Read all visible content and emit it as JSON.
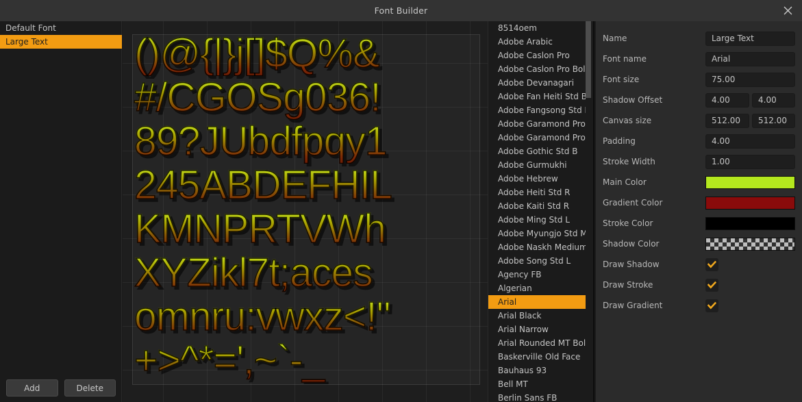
{
  "window": {
    "title": "Font Builder",
    "close_icon": "close-icon"
  },
  "left_panel": {
    "documents": [
      {
        "label": "Default Font",
        "selected": false
      },
      {
        "label": "Large Text",
        "selected": true
      }
    ],
    "add_label": "Add",
    "delete_label": "Delete"
  },
  "canvas": {
    "atlas_rows": [
      "()@{|}j[]$Q%&",
      "#/CGOSg036!",
      "89?JUbdfpqy1",
      "245ABDEFHIL",
      "KMNPRTVWh",
      "XYZikl7t;aces",
      "omnru:vwxz<!\"",
      "+>^*=',~`-_"
    ]
  },
  "font_list": {
    "items": [
      {
        "label": "8514oem",
        "selected": false
      },
      {
        "label": "Adobe Arabic",
        "selected": false
      },
      {
        "label": "Adobe Caslon Pro",
        "selected": false
      },
      {
        "label": "Adobe Caslon Pro Bold",
        "selected": false
      },
      {
        "label": "Adobe Devanagari",
        "selected": false
      },
      {
        "label": "Adobe Fan Heiti Std B",
        "selected": false
      },
      {
        "label": "Adobe Fangsong Std R",
        "selected": false
      },
      {
        "label": "Adobe Garamond Pro",
        "selected": false
      },
      {
        "label": "Adobe Garamond Pro B...",
        "selected": false
      },
      {
        "label": "Adobe Gothic Std B",
        "selected": false
      },
      {
        "label": "Adobe Gurmukhi",
        "selected": false
      },
      {
        "label": "Adobe Hebrew",
        "selected": false
      },
      {
        "label": "Adobe Heiti Std R",
        "selected": false
      },
      {
        "label": "Adobe Kaiti Std R",
        "selected": false
      },
      {
        "label": "Adobe Ming Std L",
        "selected": false
      },
      {
        "label": "Adobe Myungjo Std M",
        "selected": false
      },
      {
        "label": "Adobe Naskh Medium",
        "selected": false
      },
      {
        "label": "Adobe Song Std L",
        "selected": false
      },
      {
        "label": "Agency FB",
        "selected": false
      },
      {
        "label": "Algerian",
        "selected": false
      },
      {
        "label": "Arial",
        "selected": true
      },
      {
        "label": "Arial Black",
        "selected": false
      },
      {
        "label": "Arial Narrow",
        "selected": false
      },
      {
        "label": "Arial Rounded MT Bold",
        "selected": false
      },
      {
        "label": "Baskerville Old Face",
        "selected": false
      },
      {
        "label": "Bauhaus 93",
        "selected": false
      },
      {
        "label": "Bell MT",
        "selected": false
      },
      {
        "label": "Berlin Sans FB",
        "selected": false
      }
    ]
  },
  "properties": {
    "name": {
      "label": "Name",
      "value": "Large Text"
    },
    "font_name": {
      "label": "Font name",
      "value": "Arial"
    },
    "font_size": {
      "label": "Font size",
      "value": "75.00"
    },
    "shadow_offset": {
      "label": "Shadow Offset",
      "x": "4.00",
      "y": "4.00"
    },
    "canvas_size": {
      "label": "Canvas size",
      "width": "512.00",
      "height": "512.00"
    },
    "padding": {
      "label": "Padding",
      "value": "4.00"
    },
    "stroke_width": {
      "label": "Stroke Width",
      "value": "1.00"
    },
    "main_color": {
      "label": "Main Color",
      "value": "#b4e81e"
    },
    "gradient_color": {
      "label": "Gradient Color",
      "value": "#8a0b0b"
    },
    "stroke_color": {
      "label": "Stroke Color",
      "value": "#000000"
    },
    "shadow_color": {
      "label": "Shadow Color",
      "value": "transparent-checker"
    },
    "draw_shadow": {
      "label": "Draw Shadow",
      "checked": true
    },
    "draw_stroke": {
      "label": "Draw Stroke",
      "checked": true
    },
    "draw_gradient": {
      "label": "Draw Gradient",
      "checked": true
    }
  }
}
